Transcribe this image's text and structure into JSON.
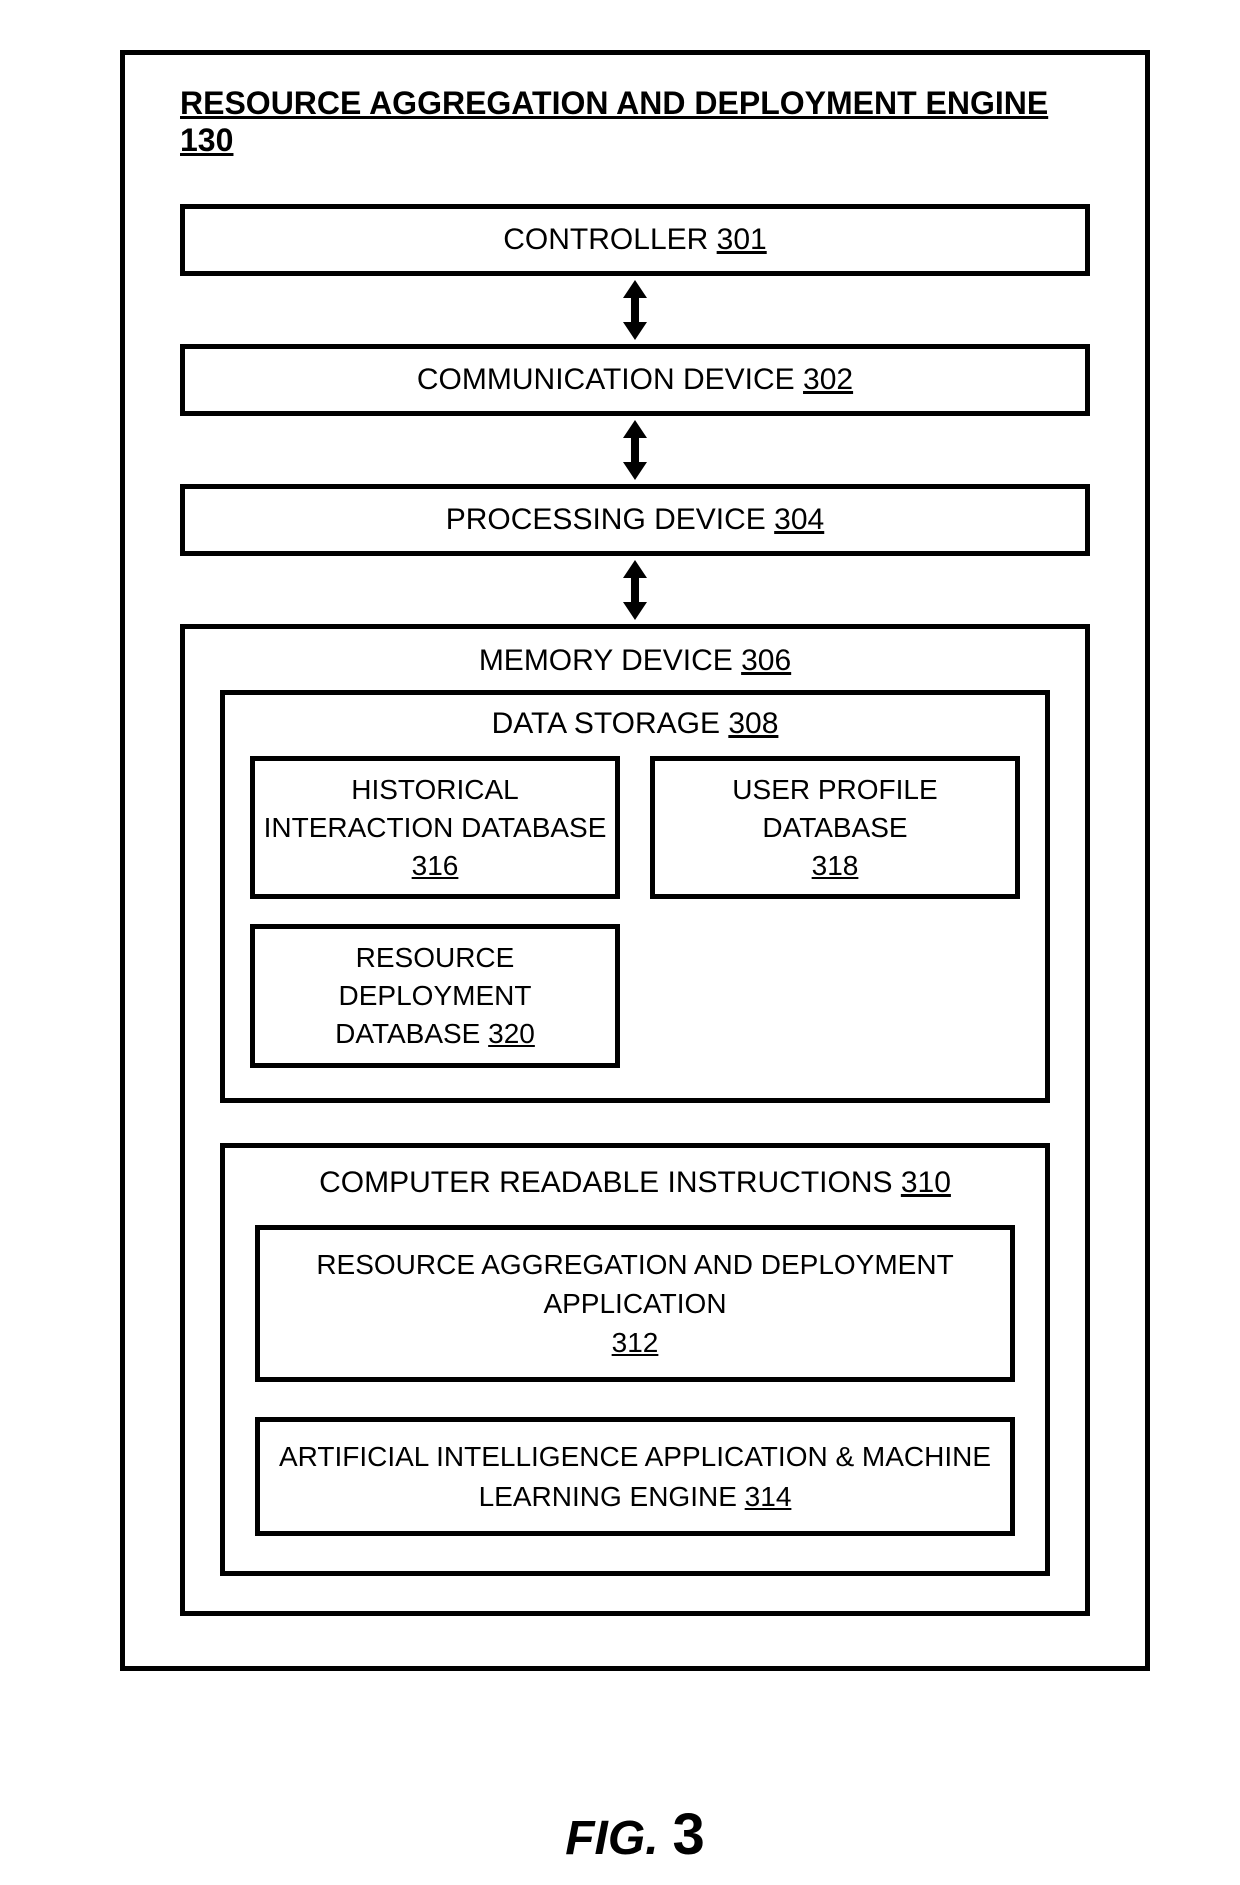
{
  "title_text": "RESOURCE AGGREGATION AND DEPLOYMENT ENGINE",
  "title_ref": "130",
  "controller": {
    "label": "CONTROLLER",
    "ref": "301"
  },
  "comm": {
    "label": "COMMUNICATION DEVICE",
    "ref": "302"
  },
  "proc": {
    "label": "PROCESSING DEVICE",
    "ref": "304"
  },
  "memory": {
    "label": "MEMORY DEVICE",
    "ref": "306"
  },
  "data_storage": {
    "label": "DATA STORAGE",
    "ref": "308",
    "items": [
      {
        "label": "HISTORICAL INTERACTION DATABASE",
        "ref": "316"
      },
      {
        "label": "USER PROFILE DATABASE",
        "ref": "318"
      },
      {
        "label": "RESOURCE DEPLOYMENT DATABASE",
        "ref": "320"
      }
    ]
  },
  "cri": {
    "label": "COMPUTER READABLE INSTRUCTIONS",
    "ref": "310",
    "items": [
      {
        "label": "RESOURCE AGGREGATION AND DEPLOYMENT APPLICATION",
        "ref": "312"
      },
      {
        "label": "ARTIFICIAL INTELLIGENCE APPLICATION & MACHINE LEARNING ENGINE",
        "ref": "314"
      }
    ]
  },
  "figure": {
    "prefix": "FIG.",
    "num": "3"
  }
}
